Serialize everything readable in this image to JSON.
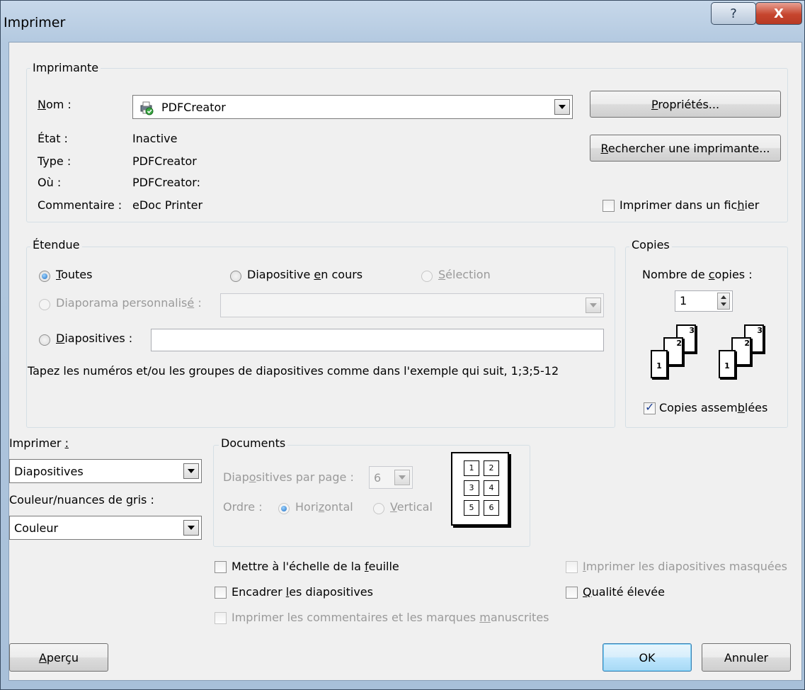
{
  "window": {
    "title": "Imprimer",
    "help_label": "?",
    "close_label": "X"
  },
  "printer": {
    "group_label": "Imprimante",
    "name_label": "Nom :",
    "name_value": "PDFCreator",
    "status_label": "État :",
    "status_value": "Inactive",
    "type_label": "Type :",
    "type_value": "PDFCreator",
    "where_label": "Où :",
    "where_value": "PDFCreator:",
    "comment_label": "Commentaire :",
    "comment_value": "eDoc Printer",
    "properties_button": "Propriétés...",
    "find_printer_button": "Rechercher une imprimante...",
    "print_to_file_label": "Imprimer dans un fichier",
    "print_to_file_checked": false
  },
  "range": {
    "group_label": "Étendue",
    "all_label": "Toutes",
    "current_slide_label": "Diapositive en cours",
    "selection_label": "Sélection",
    "custom_show_label": "Diaporama personnalisé :",
    "slides_label": "Diapositives :",
    "slides_value": "",
    "hint": "Tapez les numéros et/ou les groupes de diapositives comme dans l'exemple qui suit, 1;3;5-12",
    "selected": "all"
  },
  "copies": {
    "group_label": "Copies",
    "count_label": "Nombre de copies :",
    "count_value": "1",
    "collate_label": "Copies assemblées",
    "collate_checked": true,
    "page_numbers": [
      "1",
      "2",
      "3"
    ]
  },
  "print_what": {
    "label": "Imprimer :",
    "value": "Diapositives",
    "color_label": "Couleur/nuances de gris :",
    "color_value": "Couleur"
  },
  "documents": {
    "group_label": "Documents",
    "slides_per_page_label": "Diapositives par page :",
    "slides_per_page_value": "6",
    "order_label": "Ordre :",
    "horizontal_label": "Horizontal",
    "vertical_label": "Vertical",
    "preview_numbers": [
      "1",
      "2",
      "3",
      "4",
      "5",
      "6"
    ]
  },
  "options": {
    "scale_to_fit_label": "Mettre à l'échelle de la feuille",
    "frame_slides_label": "Encadrer les diapositives",
    "print_comments_label": "Imprimer les commentaires et les marques manuscrites",
    "print_hidden_label": "Imprimer les diapositives masquées",
    "high_quality_label": "Qualité élevée"
  },
  "footer": {
    "preview_button": "Aperçu",
    "ok_button": "OK",
    "cancel_button": "Annuler"
  }
}
